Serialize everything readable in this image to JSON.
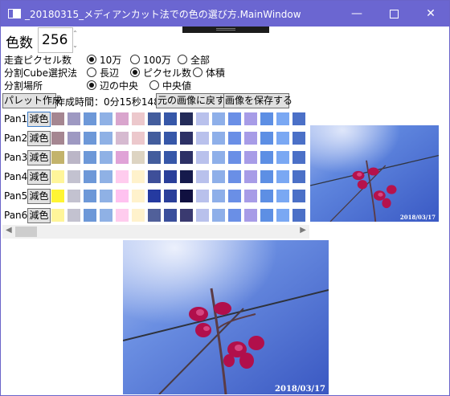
{
  "window": {
    "title": "_20180315_メディアンカット法での色の選び方.MainWindow",
    "accent_color": "#6b66d1",
    "minimize_glyph": "—",
    "close_glyph": "✕"
  },
  "color_count": {
    "label": "色数",
    "value": "256",
    "spin_up": "⌃",
    "spin_down": "⌄"
  },
  "settings": {
    "scan_pixels": {
      "label": "走査ピクセル数",
      "options": [
        "10万",
        "100万",
        "全部"
      ],
      "selected": 0
    },
    "cube_select": {
      "label": "分割Cube選択法",
      "options": [
        "長辺",
        "ピクセル数",
        "体積"
      ],
      "selected": 1
    },
    "split_place": {
      "label": "分割場所",
      "options": [
        "辺の中央",
        "中央値"
      ],
      "selected": 0
    }
  },
  "toolbar": {
    "create_palette": "パレット作成",
    "time_label": "作成時間：",
    "time_value": "0分15秒148",
    "restore_image": "元の画像に戻す",
    "save_image": "画像を保存する"
  },
  "palette_rows": [
    {
      "label": "Pan1",
      "button": "減色",
      "colors": [
        "#a58691",
        "#9e99c2",
        "#6d98d8",
        "#8fb1e5",
        "#d9a5cd",
        "#ecc8cc",
        "#435d9d",
        "#3657a8",
        "#242c59",
        "#b9c1ec",
        "#8eafe9",
        "#6a8fe6",
        "#a79ce7",
        "#5d8fe4",
        "#7aa8f3",
        "#4b70c7"
      ]
    },
    {
      "label": "Pan2",
      "button": "減色",
      "colors": [
        "#a58691",
        "#9e99c2",
        "#6d98d8",
        "#8fb1e5",
        "#d6bad0",
        "#ecc8cc",
        "#435d9d",
        "#3657a8",
        "#2d3166",
        "#b9c1ec",
        "#8eafe9",
        "#6a8fe6",
        "#a79ce7",
        "#5d8fe4",
        "#7aa8f3",
        "#4b70c7"
      ]
    },
    {
      "label": "Pan3",
      "button": "減色",
      "colors": [
        "#c3b36c",
        "#bbb6c7",
        "#6d98d8",
        "#8fb1e5",
        "#e0a3d7",
        "#ddd4c2",
        "#435d9d",
        "#3657a8",
        "#2d3166",
        "#b9c1ec",
        "#8eafe9",
        "#6a8fe6",
        "#a79ce7",
        "#5d8fe4",
        "#7aa8f3",
        "#4b70c7"
      ]
    },
    {
      "label": "Pan4",
      "button": "減色",
      "colors": [
        "#fff59a",
        "#c3c2d0",
        "#6d98d8",
        "#8fb1e5",
        "#ffccee",
        "#fff2cc",
        "#3e4f99",
        "#2a3f9a",
        "#151a4c",
        "#b9c1ec",
        "#8eafe9",
        "#6a8fe6",
        "#a79ce7",
        "#5d8fe4",
        "#7aa8f3",
        "#4b70c7"
      ]
    },
    {
      "label": "Pan5",
      "button": "減色",
      "colors": [
        "#fff533",
        "#c3c2d0",
        "#6d98d8",
        "#8fb1e5",
        "#ffc2f0",
        "#fff2cc",
        "#253aa0",
        "#2a3f9a",
        "#101040",
        "#b9c1ec",
        "#8eafe9",
        "#6a8fe6",
        "#a79ce7",
        "#5d8fe4",
        "#7aa8f3",
        "#4b70c7"
      ]
    },
    {
      "label": "Pan6",
      "button": "減色",
      "colors": [
        "#fff59a",
        "#c3c2d0",
        "#6d98d8",
        "#8fb1e5",
        "#ffccee",
        "#fff2cc",
        "#51609a",
        "#3a4f9c",
        "#3a3a70",
        "#b9c1ec",
        "#8eafe9",
        "#6a8fe6",
        "#a79ce7",
        "#5d8fe4",
        "#7aa8f3",
        "#4b70c7"
      ]
    }
  ],
  "photo": {
    "date_stamp": "2018/03/17"
  }
}
